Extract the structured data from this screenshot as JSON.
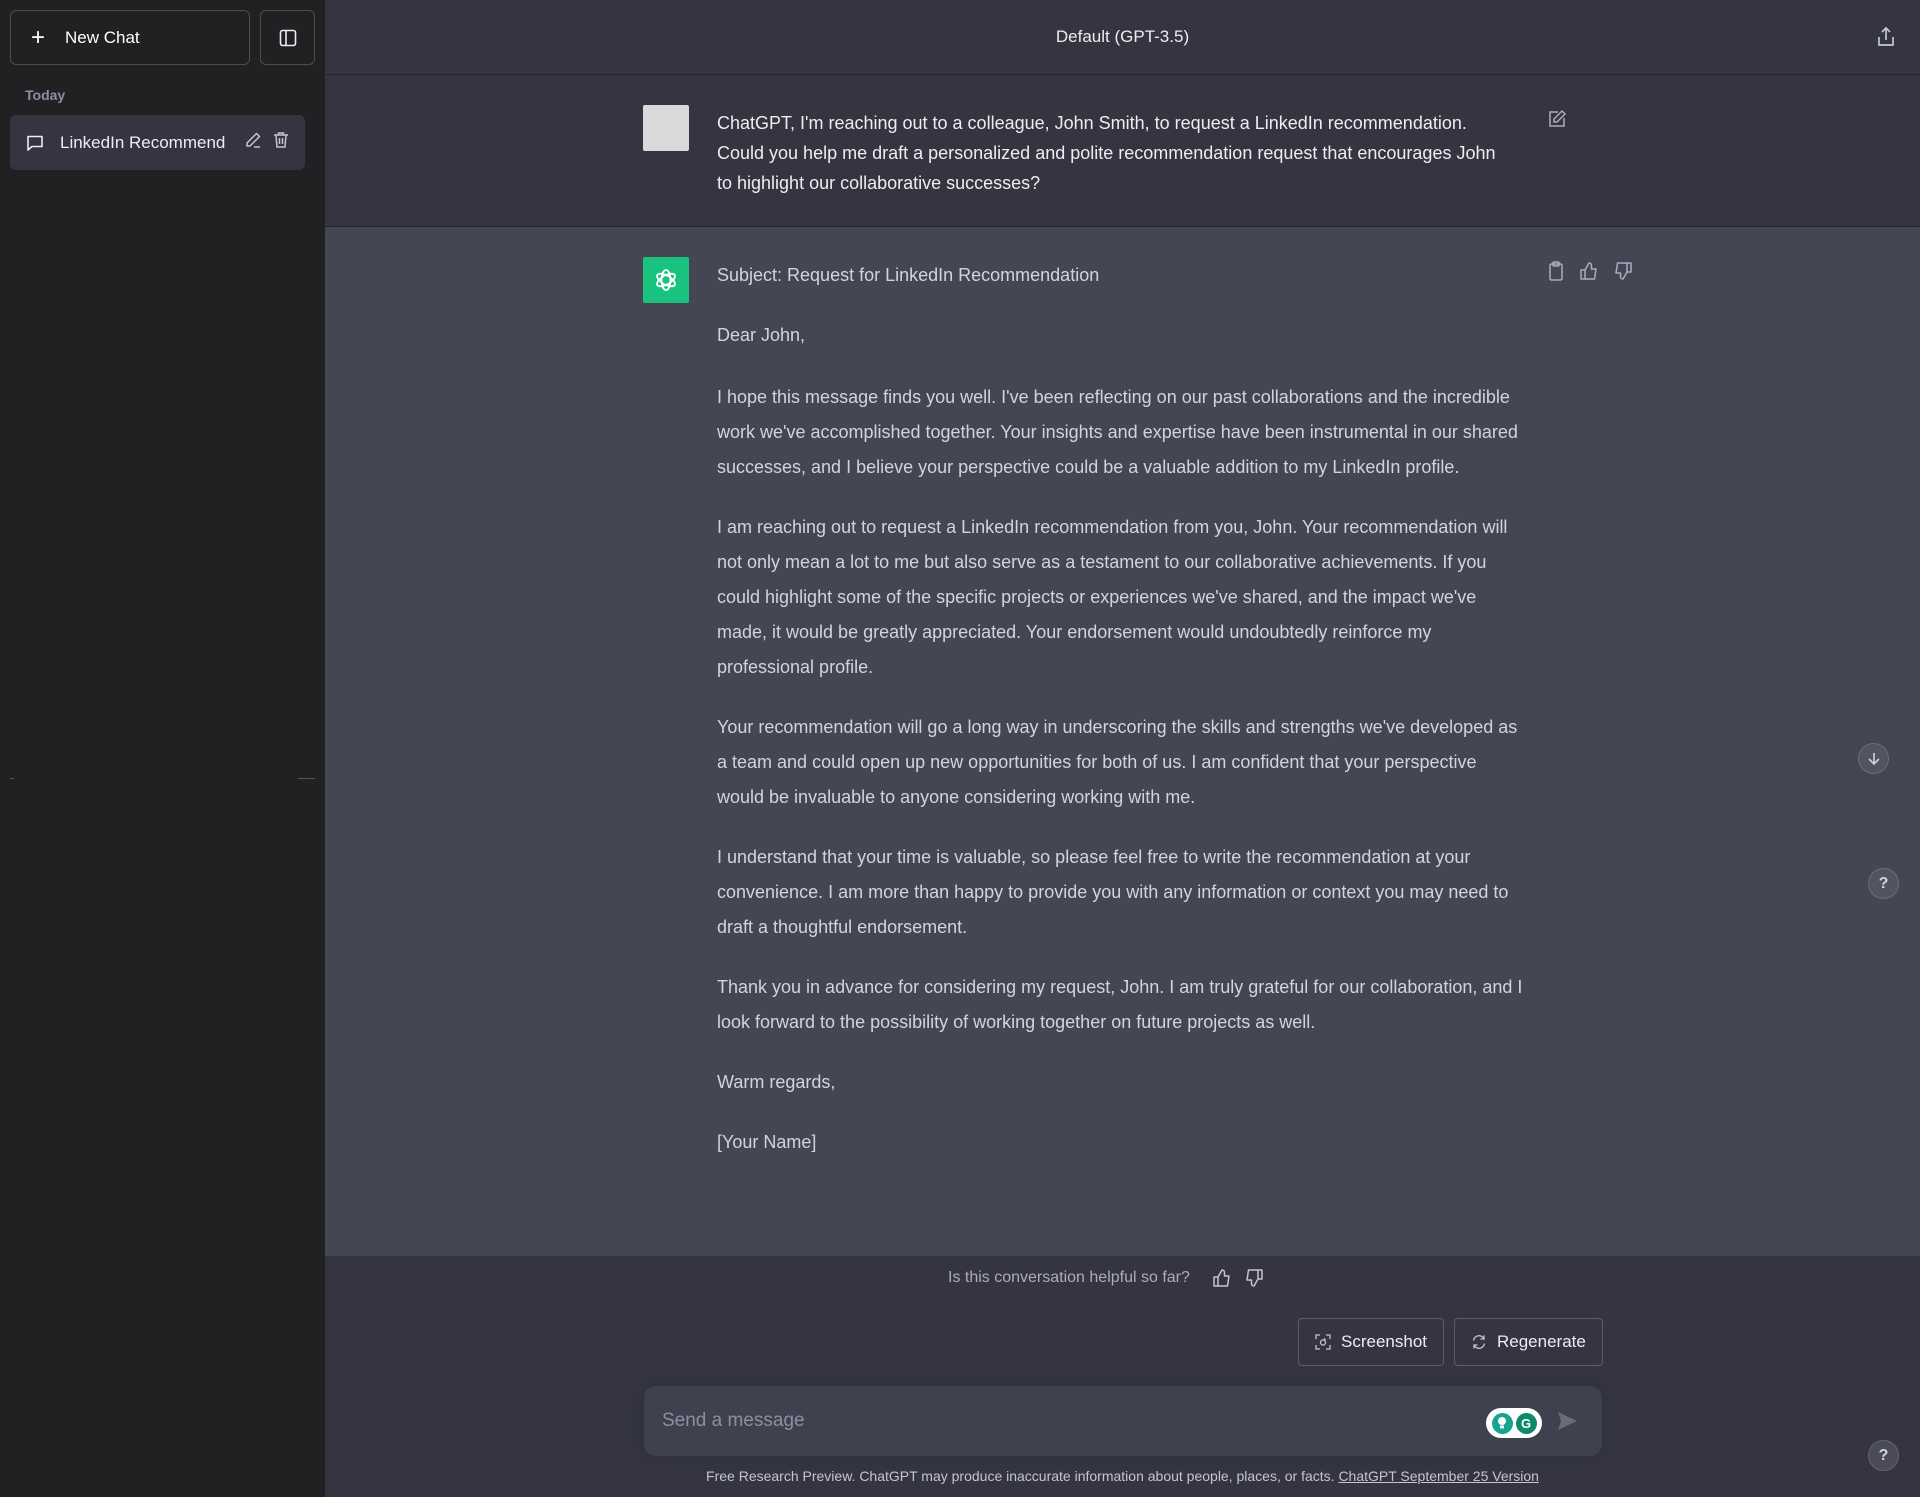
{
  "sidebar": {
    "new_chat_label": "New Chat",
    "section_label": "Today",
    "chats": [
      {
        "label": "LinkedIn Recommend"
      }
    ]
  },
  "header": {
    "title": "Default (GPT-3.5)"
  },
  "conversation": {
    "user_message": "ChatGPT, I'm reaching out to a colleague, John Smith, to request a LinkedIn recommendation. Could you help me draft a personalized and polite recommendation request that encourages John to highlight our collaborative successes?",
    "assistant_paragraphs": [
      "Subject: Request for LinkedIn Recommendation",
      "Dear John,",
      "I hope this message finds you well. I've been reflecting on our past collaborations and the incredible work we've accomplished together. Your insights and expertise have been instrumental in our shared successes, and I believe your perspective could be a valuable addition to my LinkedIn profile.",
      "I am reaching out to request a LinkedIn recommendation from you, John. Your recommendation will not only mean a lot to me but also serve as a testament to our collaborative achievements. If you could highlight some of the specific projects or experiences we've shared, and the impact we've made, it would be greatly appreciated. Your endorsement would undoubtedly reinforce my professional profile.",
      "Your recommendation will go a long way in underscoring the skills and strengths we've developed as a team and could open up new opportunities for both of us. I am confident that your perspective would be invaluable to anyone considering working with me.",
      "I understand that your time is valuable, so please feel free to write the recommendation at your convenience. I am more than happy to provide you with any information or context you may need to draft a thoughtful endorsement.",
      "Thank you in advance for considering my request, John. I am truly grateful for our collaboration, and I look forward to the possibility of working together on future projects as well.",
      "Warm regards,",
      "[Your Name]"
    ]
  },
  "feedback": {
    "question": "Is this conversation helpful so far?"
  },
  "actions": {
    "screenshot_label": "Screenshot",
    "regenerate_label": "Regenerate"
  },
  "composer": {
    "placeholder": "Send a message",
    "value": "",
    "extension_letter": "G"
  },
  "footer": {
    "disclaimer": "Free Research Preview. ChatGPT may produce inaccurate information about people, places, or facts. ",
    "version_link": "ChatGPT September 25 Version"
  },
  "floating": {
    "help_label": "?"
  },
  "colors": {
    "sidebar_bg": "#202123",
    "main_bg": "#343541",
    "assistant_bg": "#444654",
    "brand_green": "#19c37d",
    "input_bg": "#40414f"
  }
}
